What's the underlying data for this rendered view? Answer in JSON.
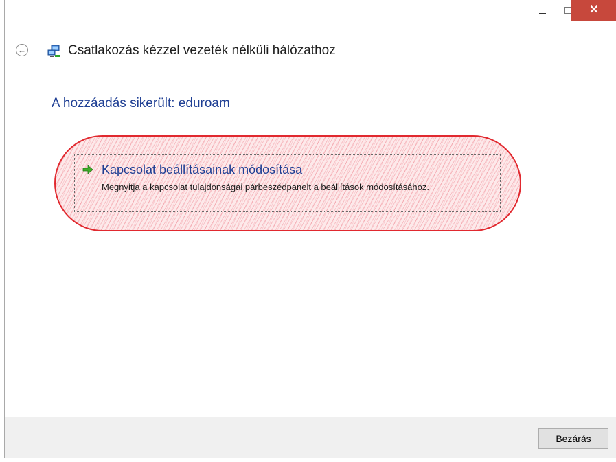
{
  "window": {
    "title": "Csatlakozás kézzel vezeték nélküli hálózathoz"
  },
  "heading": "A hozzáadás sikerült: eduroam",
  "link": {
    "title": "Kapcsolat beállításainak módosítása",
    "description": "Megnyitja a kapcsolat tulajdonságai párbeszédpanelt a beállítások módosításához."
  },
  "footer": {
    "close_label": "Bezárás"
  },
  "colors": {
    "accent_blue": "#1f3f94",
    "close_button_red": "#c7483c",
    "highlight_red": "#e1292f"
  },
  "icons": {
    "back": "back-arrow-icon",
    "network": "network-icon",
    "link": "green-arrow-icon",
    "minimize": "minimize-icon",
    "maximize": "maximize-icon",
    "close": "close-icon"
  }
}
